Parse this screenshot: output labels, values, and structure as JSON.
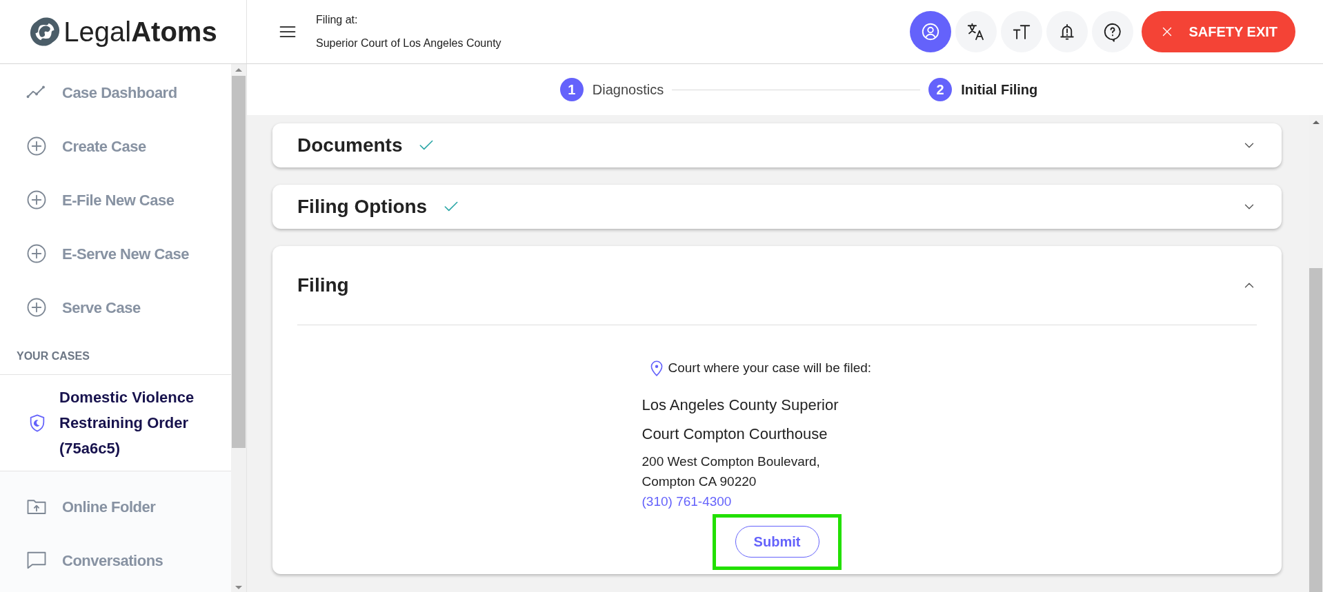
{
  "header": {
    "logo": {
      "light": "Legal",
      "bold": "Atoms"
    },
    "filing_label": "Filing at:",
    "court": "Superior Court of Los Angeles County",
    "icon_buttons": [
      {
        "kind": "account",
        "selected": true
      },
      {
        "kind": "translate",
        "selected": false
      },
      {
        "kind": "text-size",
        "selected": false
      },
      {
        "kind": "notifications",
        "selected": false
      },
      {
        "kind": "help",
        "selected": false
      }
    ],
    "safety_exit": "SAFETY EXIT"
  },
  "sidebar": {
    "items": [
      {
        "kind": "chart",
        "label": "Case Dashboard"
      },
      {
        "kind": "plus",
        "label": "Create Case"
      },
      {
        "kind": "plus",
        "label": "E-File New Case"
      },
      {
        "kind": "plus",
        "label": "E-Serve New Case"
      },
      {
        "kind": "plus",
        "label": "Serve Case"
      }
    ],
    "cases_heading": "YOUR CASES",
    "cases": [
      {
        "title": "Domestic Violence Restraining Order (75a6c5)",
        "selected": true
      }
    ],
    "bottom_items": [
      {
        "kind": "folder",
        "label": "Online Folder"
      },
      {
        "kind": "chat",
        "label": "Conversations"
      }
    ]
  },
  "stepper": [
    {
      "number": "1",
      "label": "Diagnostics",
      "selected": false
    },
    {
      "number": "2",
      "label": "Initial Filing",
      "selected": true
    }
  ],
  "sections": [
    {
      "title": "Documents",
      "completed": true,
      "expanded": false
    },
    {
      "title": "Filing Options",
      "completed": true,
      "expanded": false
    },
    {
      "title": "Filing",
      "completed": false,
      "expanded": true
    }
  ],
  "filing": {
    "court_label": "Court where your case will be filed:",
    "court_name": [
      "Los Angeles County Superior",
      "Court Compton Courthouse"
    ],
    "address": [
      "200 West Compton Boulevard,",
      "Compton CA 90220"
    ],
    "phone": "(310) 761-4300",
    "submit": {
      "label": "Submit",
      "highlighted": true
    }
  }
}
